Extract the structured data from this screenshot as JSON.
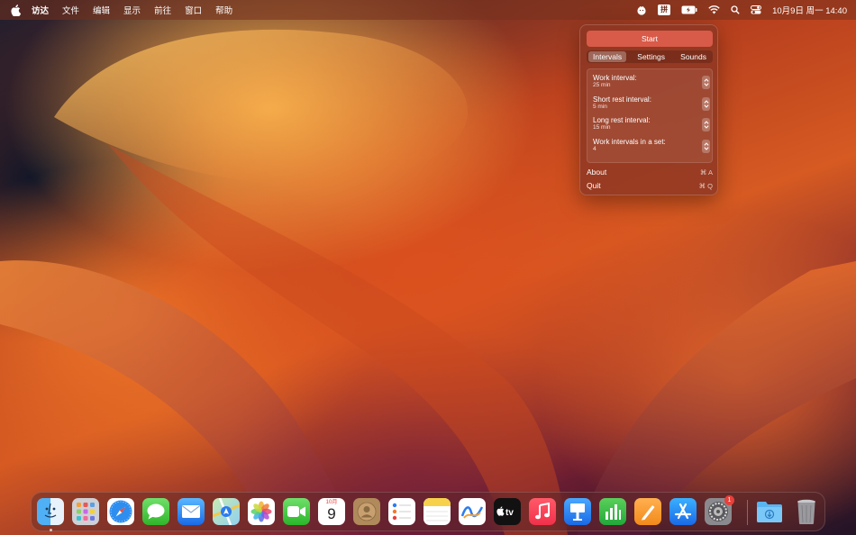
{
  "menubar": {
    "app_name": "访达",
    "items": [
      "文件",
      "编辑",
      "显示",
      "前往",
      "窗口",
      "帮助"
    ],
    "input_method": "拼",
    "clock": "10月9日 周一 14:40"
  },
  "popover": {
    "start_label": "Start",
    "tabs": [
      {
        "label": "Intervals",
        "active": true
      },
      {
        "label": "Settings",
        "active": false
      },
      {
        "label": "Sounds",
        "active": false
      }
    ],
    "settings": [
      {
        "label": "Work interval:",
        "value": "25 min"
      },
      {
        "label": "Short rest interval:",
        "value": "5 min"
      },
      {
        "label": "Long rest interval:",
        "value": "15 min"
      },
      {
        "label": "Work intervals in a set:",
        "value": "4"
      }
    ],
    "about_label": "About",
    "about_shortcut": "⌘ A",
    "quit_label": "Quit",
    "quit_shortcut": "⌘ Q"
  },
  "dock": {
    "calendar_month": "10月",
    "calendar_day": "9",
    "settings_badge": "1",
    "apps": [
      "finder-icon",
      "launchpad-icon",
      "safari-icon",
      "messages-icon",
      "mail-icon",
      "maps-icon",
      "photos-icon",
      "facetime-icon",
      "calendar-icon",
      "contacts-icon",
      "reminders-icon",
      "notes-icon",
      "freeform-icon",
      "apple-tv-icon",
      "music-icon",
      "keynote-icon",
      "numbers-icon",
      "pages-icon",
      "app-store-icon",
      "system-settings-icon",
      "downloads-folder-icon",
      "trash-icon"
    ]
  },
  "colors": {
    "accent_start_button": "#d85a48",
    "popover_bg": "#8c3723"
  }
}
